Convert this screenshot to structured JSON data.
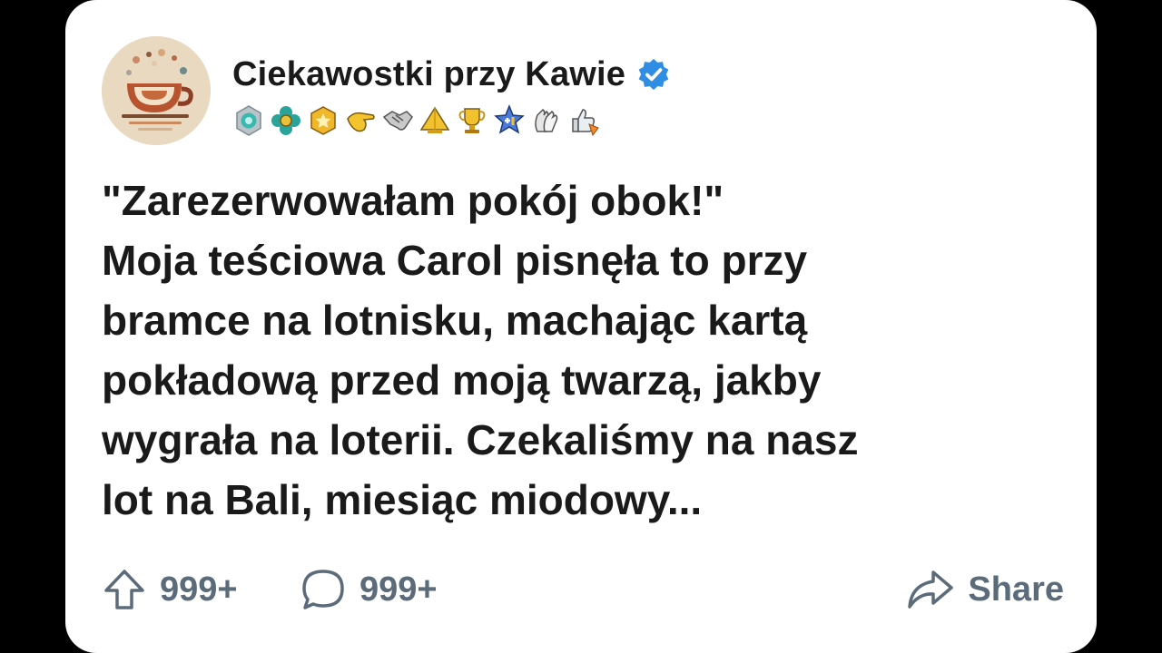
{
  "author": {
    "name": "Ciekawostki przy Kawie",
    "verified": true,
    "verified_color": "#2f8de4",
    "avatar_icon": "coffee-cup-icon",
    "badges": [
      "teal-gem-badge-icon",
      "teal-flower-badge-icon",
      "gold-star-badge-icon",
      "pointing-hand-badge-icon",
      "handshake-badge-icon",
      "gold-pyramid-badge-icon",
      "gold-trophy-badge-icon",
      "plus-one-star-badge-icon",
      "clapping-hands-badge-icon",
      "thumbs-up-badge-icon"
    ]
  },
  "post": {
    "lines": [
      "\"Zarezerwowałam pokój obok!\"",
      "Moja teściowa Carol pisnęła to przy",
      "bramce na lotnisku, machając kartą",
      "pokładową przed moją twarzą, jakby",
      "wygrała na loterii. Czekaliśmy na nasz",
      "lot na Bali, miesiąc miodowy..."
    ]
  },
  "actions": {
    "upvote": {
      "icon": "upvote-arrow-icon",
      "count": "999+"
    },
    "comments": {
      "icon": "comment-bubble-icon",
      "count": "999+"
    },
    "share": {
      "icon": "share-arrow-icon",
      "label": "Share"
    }
  },
  "colors": {
    "background": "#000000",
    "card": "#ffffff",
    "text": "#1a1a1b",
    "action_gray": "#5c6b7a"
  }
}
